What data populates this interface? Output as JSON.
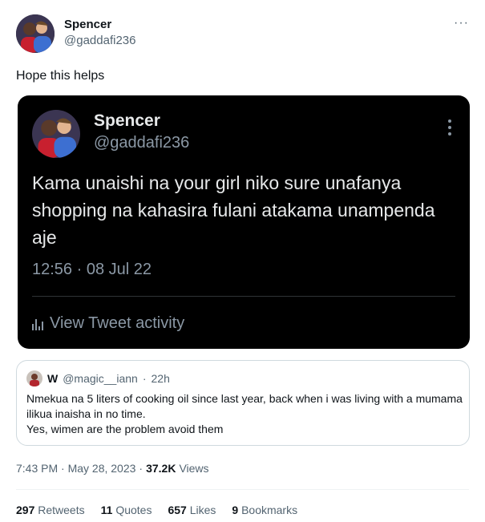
{
  "author": {
    "name": "Spencer",
    "handle": "@gaddafi236"
  },
  "more_label": "···",
  "tweet_text": "Hope this helps",
  "screenshot": {
    "name": "Spencer",
    "handle": "@gaddafi236",
    "body": "Kama unaishi na your girl niko sure unafanya shopping na kahasira fulani atakama unampenda aje",
    "time": "12:56 · 08 Jul 22",
    "activity_label": "View Tweet activity"
  },
  "quoted": {
    "name": "W",
    "handle": "@magic__iann",
    "dot": "·",
    "age": "22h",
    "line1": "Nmekua na 5 liters of cooking oil since last year, back when i was living with a mumama ilikua inaisha in no time.",
    "line2": "Yes, wimen are the problem avoid them"
  },
  "meta": {
    "timestamp": "7:43 PM · May 28, 2023",
    "sep": "·",
    "views_count": "37.2K",
    "views_label": "Views"
  },
  "stats": {
    "retweets": {
      "num": "297",
      "label": "Retweets"
    },
    "quotes": {
      "num": "11",
      "label": "Quotes"
    },
    "likes": {
      "num": "657",
      "label": "Likes"
    },
    "bookmarks": {
      "num": "9",
      "label": "Bookmarks"
    }
  },
  "icons": [
    "more-icon",
    "avatar",
    "bar-chart-icon",
    "vertical-more-icon"
  ]
}
